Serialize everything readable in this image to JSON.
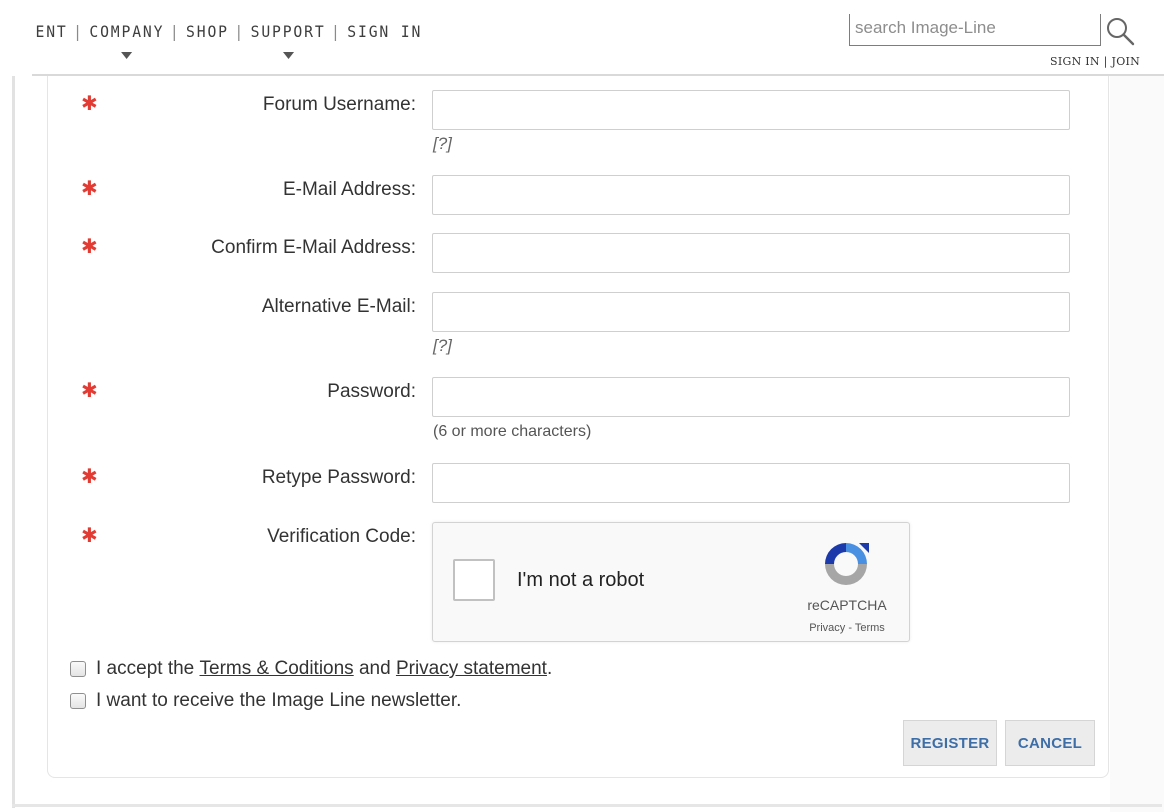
{
  "nav": {
    "items": [
      {
        "label": "ENT",
        "caret": false
      },
      {
        "label": "COMPANY",
        "caret": true
      },
      {
        "label": "SHOP",
        "caret": false
      },
      {
        "label": "SUPPORT",
        "caret": true
      },
      {
        "label": "SIGN IN",
        "caret": false
      }
    ],
    "separator": "|",
    "search_placeholder": "search Image-Line",
    "auth_sign_in": "SIGN IN",
    "auth_separator": "|",
    "auth_join": "JOIN"
  },
  "form": {
    "required_marker": "✱",
    "fields": {
      "forum_username": {
        "label": "Forum Username:",
        "value": "",
        "hint": "[?]"
      },
      "email": {
        "label": "E-Mail Address:",
        "value": ""
      },
      "confirm_email": {
        "label": "Confirm E-Mail Address:",
        "value": ""
      },
      "alt_email": {
        "label": "Alternative E-Mail:",
        "value": "",
        "hint": "[?]"
      },
      "password": {
        "label": "Password:",
        "value": "",
        "hint": "(6 or more characters)"
      },
      "retype_password": {
        "label": "Retype Password:",
        "value": ""
      },
      "verification": {
        "label": "Verification Code:"
      }
    },
    "recaptcha": {
      "checkbox_label": "I'm not a robot",
      "brand": "reCAPTCHA",
      "links": "Privacy - Terms"
    },
    "accept_terms": {
      "prefix": "I accept the",
      "terms_link": "Terms & Coditions",
      "and": "and",
      "privacy_link": "Privacy statement",
      "suffix": ".",
      "checked": false
    },
    "newsletter": {
      "label": "I want to receive the Image Line newsletter.",
      "checked": false
    },
    "buttons": {
      "register": "REGISTER",
      "cancel": "CANCEL"
    }
  },
  "colors": {
    "required": "#e23b33",
    "button_text": "#3d6ea8",
    "recaptcha_blue": "#4a90e2",
    "recaptcha_dark_blue": "#1c3aa9",
    "recaptcha_gray": "#a6a6a6"
  }
}
